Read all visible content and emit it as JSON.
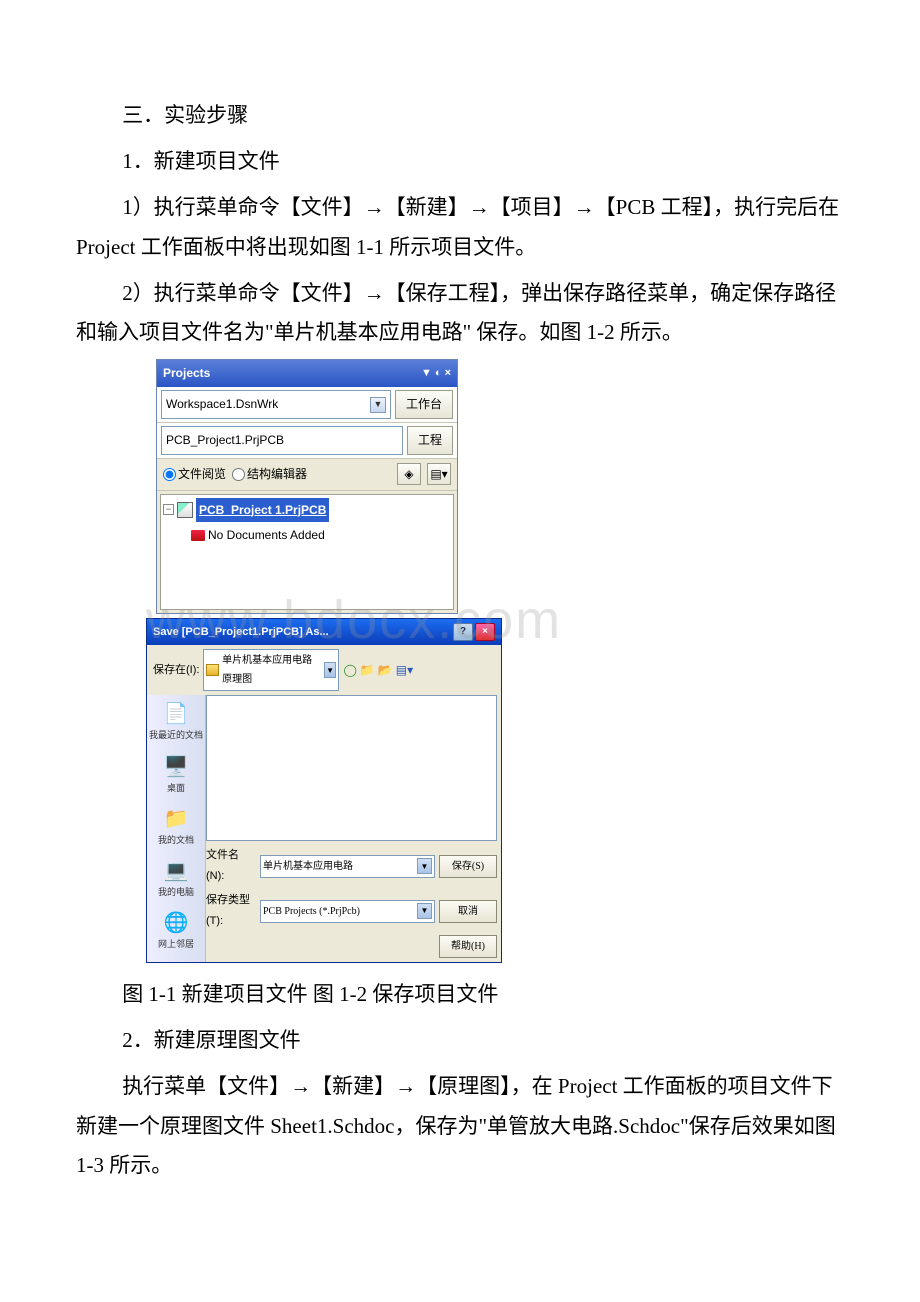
{
  "doc": {
    "heading_section": "三．实验步骤",
    "step1_title": "1．新建项目文件",
    "step1_p1": "1）执行菜单命令【文件】→【新建】→【项目】→【PCB 工程】，执行完后在 Project 工作面板中将出现如图 1-1 所示项目文件。",
    "step1_p2": "2）执行菜单命令【文件】→【保存工程】，弹出保存路径菜单，确定保存路径和输入项目文件名为\"单片机基本应用电路\" 保存。如图 1-2 所示。",
    "caption12": "图 1-1 新建项目文件 图 1-2 保存项目文件",
    "step2_title": "2．新建原理图文件",
    "step2_p1": "执行菜单【文件】→【新建】→【原理图】，在 Project 工作面板的项目文件下新建一个原理图文件 Sheet1.Schdoc，保存为\"单管放大电路.Schdoc\"保存后效果如图 1-3 所示。"
  },
  "projects_panel": {
    "title": "Projects",
    "workspace": "Workspace1.DsnWrk",
    "workspace_btn": "工作台",
    "project": "PCB_Project1.PrjPCB",
    "project_btn": "工程",
    "radio_fileview": "文件阅览",
    "radio_structure": "结构编辑器",
    "tree_root": "PCB_Project 1.PrjPCB",
    "tree_empty": "No Documents Added",
    "arrow_symbol": "▼",
    "minus": "−"
  },
  "save_dialog": {
    "title": "Save [PCB_Project1.PrjPCB] As...",
    "savein_label": "保存在(I):",
    "savein_value": "单片机基本应用电路原理图",
    "side_recent": "我最近的文档",
    "side_desktop": "桌面",
    "side_docs": "我的文档",
    "side_computer": "我的电脑",
    "side_network": "网上邻居",
    "filename_label": "文件名(N):",
    "filename_value": "单片机基本应用电路",
    "filetype_label": "保存类型(T):",
    "filetype_value": "PCB Projects (*.PrjPcb)",
    "btn_save": "保存(S)",
    "btn_cancel": "取消",
    "btn_help": "帮助(H)",
    "arrow_symbol": "▼",
    "close_x": "×",
    "help_q": "?"
  },
  "watermark": "www.bdocx.com"
}
